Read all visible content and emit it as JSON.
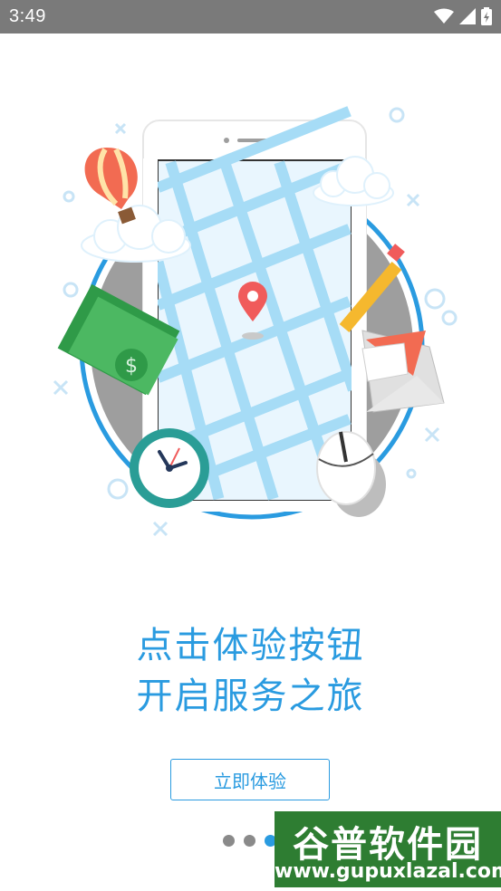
{
  "status_bar": {
    "time": "3:49",
    "icons": [
      "wifi-icon",
      "cellular-signal-icon",
      "battery-icon"
    ]
  },
  "headline": {
    "line1": "点击体验按钮",
    "line2": "开启服务之旅"
  },
  "cta": {
    "label": "立即体验"
  },
  "pager": {
    "current_page": 3,
    "total_pages": 3
  },
  "watermark": {
    "title": "谷普软件园",
    "url": "www.gupuxlazal.com"
  },
  "colors": {
    "accent": "#2a9be0",
    "status_bar": "#7a7a7a",
    "dot_inactive": "#8a8a8a",
    "watermark_bg": "#2e7d32"
  }
}
